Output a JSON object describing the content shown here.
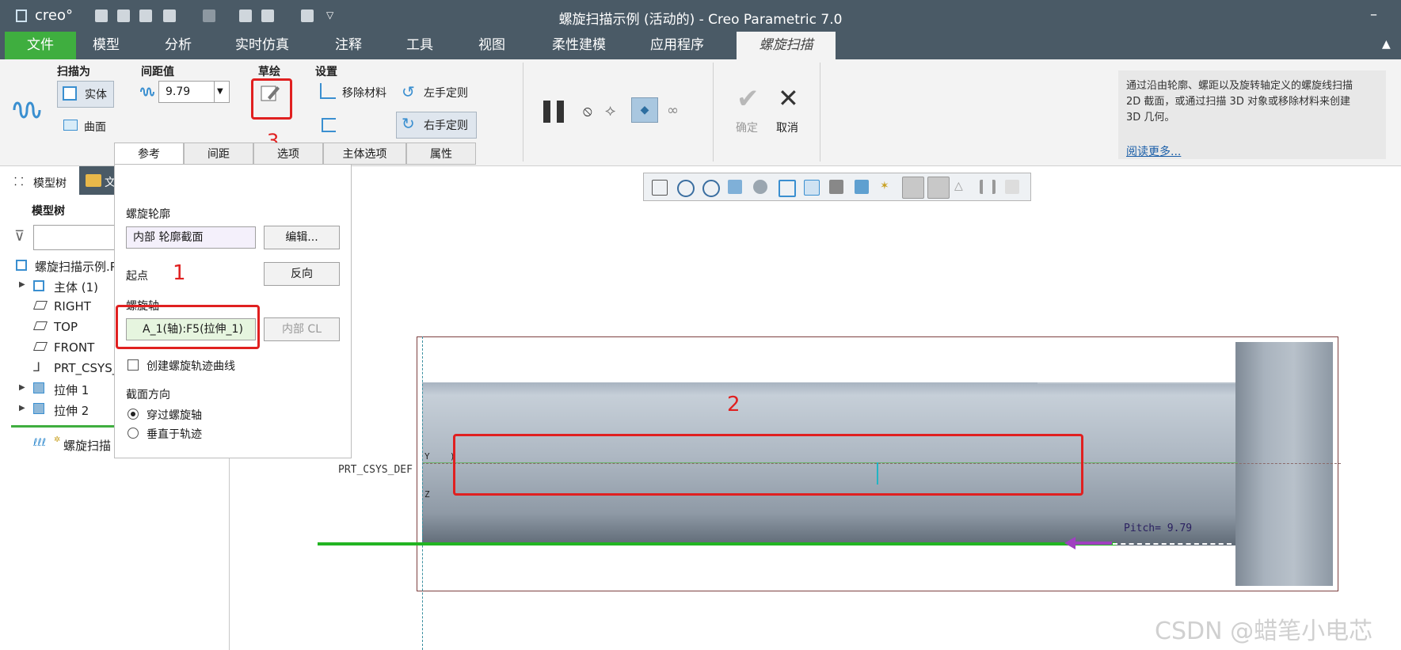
{
  "window": {
    "logo": "creo°",
    "title": "螺旋扫描示例 (活动的) - Creo Parametric 7.0"
  },
  "menu": {
    "file": "文件",
    "items": [
      "模型",
      "分析",
      "实时仿真",
      "注释",
      "工具",
      "视图",
      "柔性建模",
      "应用程序"
    ],
    "active_tab": "螺旋扫描"
  },
  "ribbon": {
    "sweep_as": {
      "label": "扫描为",
      "solid": "实体",
      "surface": "曲面"
    },
    "pitch": {
      "label": "间距值",
      "value": "9.79"
    },
    "sketch": {
      "label": "草绘"
    },
    "settings": {
      "label": "设置",
      "remove_material": "移除材料",
      "left_hand": "左手定则",
      "right_hand": "右手定则"
    },
    "confirm": "确定",
    "cancel": "取消",
    "help_text": "通过沿由轮廓、螺距以及旋转轴定义的螺旋线扫描 2D 截面，或通过扫描 3D 对象或移除材料来创建 3D 几何。",
    "read_more": "阅读更多..."
  },
  "panel": {
    "tabs": [
      "参考",
      "间距",
      "选项",
      "主体选项",
      "属性"
    ],
    "profile_label": "螺旋轮廓",
    "profile_value": "内部 轮廓截面",
    "edit_button": "编辑...",
    "start_label": "起点",
    "reverse_button": "反向",
    "axis_label": "螺旋轴",
    "axis_value": "A_1(轴):F5(拉伸_1)",
    "internal_cl": "内部 CL",
    "create_curve": "创建螺旋轨迹曲线",
    "section_dir_label": "截面方向",
    "option_through": "穿过螺旋轴",
    "option_normal": "垂直于轨迹"
  },
  "tree": {
    "tabs": [
      "模型树",
      "文"
    ],
    "header": "模型树",
    "items": [
      "螺旋扫描示例.P",
      "主体 (1)",
      "RIGHT",
      "TOP",
      "FRONT",
      "PRT_CSYS_",
      "拉伸 1",
      "拉伸 2",
      "螺旋扫描"
    ]
  },
  "viewport": {
    "csys_label": "PRT_CSYS_DEF",
    "y_label": "Y",
    "x_label": ")",
    "z_label": "Z",
    "pitch_label": "Pitch= 9.79"
  },
  "annotations": {
    "n1": "1",
    "n2": "2",
    "n3": "3"
  },
  "watermark": "CSDN @蜡笔小电芯",
  "colors": {
    "title_bg": "#4a5a66",
    "file_green": "#3fae3f",
    "highlight_red": "#e02020",
    "trajectory_green": "#22b422"
  }
}
